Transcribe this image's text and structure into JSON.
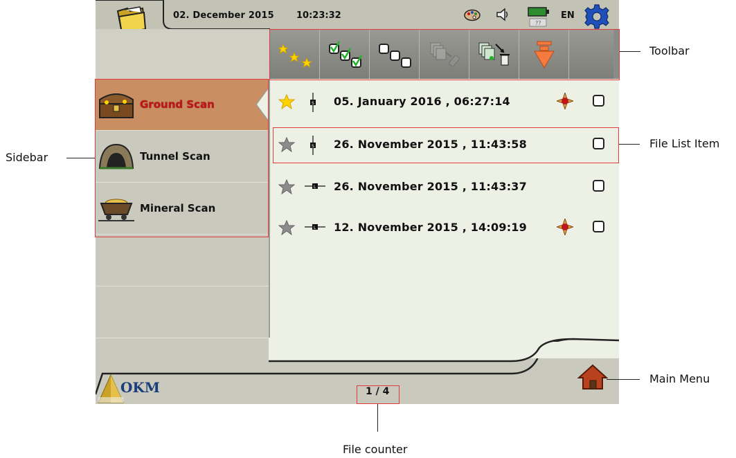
{
  "status_bar": {
    "date": "02. December  2015",
    "time": "10:23:32",
    "language": "EN"
  },
  "toolbar": {
    "buttons": [
      {
        "icon": "stars-icon"
      },
      {
        "icon": "select-all-icon"
      },
      {
        "icon": "deselect-all-icon"
      },
      {
        "icon": "export-to-usb-icon"
      },
      {
        "icon": "delete-files-icon"
      },
      {
        "icon": "import-down-icon"
      }
    ]
  },
  "sidebar": {
    "items": [
      {
        "label": "Ground Scan",
        "active": true
      },
      {
        "label": "Tunnel Scan",
        "active": false
      },
      {
        "label": "Mineral Scan",
        "active": false
      }
    ]
  },
  "file_list": {
    "items": [
      {
        "text": "05. January  2016 , 06:27:14",
        "favorite": true,
        "orientation": "vertical",
        "gps": true
      },
      {
        "text": "26. November  2015 , 11:43:58",
        "favorite": false,
        "orientation": "vertical",
        "gps": false
      },
      {
        "text": "26. November  2015 , 11:43:37",
        "favorite": false,
        "orientation": "horizontal",
        "gps": false
      },
      {
        "text": "12. November  2015 , 14:09:19",
        "favorite": false,
        "orientation": "horizontal",
        "gps": true
      }
    ]
  },
  "footer": {
    "logo_text": "OKM",
    "counter": "1 / 4"
  },
  "annotations": {
    "toolbar": "Toolbar",
    "sidebar": "Sidebar",
    "file_list_item": "File List Item",
    "main_menu": "Main Menu",
    "file_counter": "File counter"
  },
  "colors": {
    "active_tab": "#c98f63",
    "active_label": "#c0161a",
    "highlight": "#e23b3b",
    "gear": "#1f4fb8",
    "battery": "#2e8b2e"
  }
}
